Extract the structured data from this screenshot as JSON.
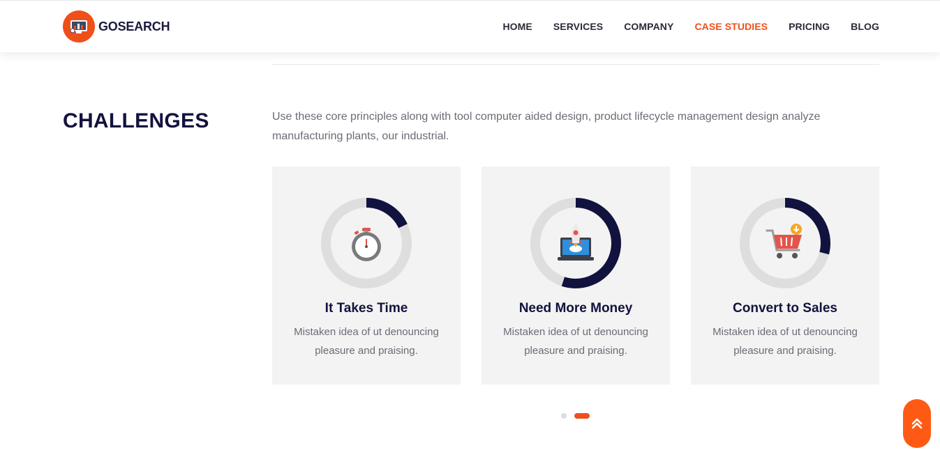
{
  "header": {
    "brand": "GOSEARCH",
    "nav": [
      {
        "label": "HOME"
      },
      {
        "label": "SERVICES"
      },
      {
        "label": "COMPANY"
      },
      {
        "label": "CASE STUDIES",
        "active": true
      },
      {
        "label": "PRICING"
      },
      {
        "label": "BLOG"
      }
    ]
  },
  "section": {
    "title": "CHALLENGES",
    "intro": "Use these core principles along with tool computer aided design, product lifecycle management design analyze manufacturing plants, our industrial."
  },
  "cards": [
    {
      "title": "It Takes Time",
      "text": "Mistaken idea of ut denouncing pleasure and praising.",
      "icon": "stopwatch-icon",
      "progress": 0.18
    },
    {
      "title": "Need More Money",
      "text": "Mistaken idea of ut denouncing pleasure and praising.",
      "icon": "rocket-laptop-icon",
      "progress": 0.55
    },
    {
      "title": "Convert to Sales",
      "text": "Mistaken idea of ut denouncing pleasure and praising.",
      "icon": "shopping-cart-icon",
      "progress": 0.29
    }
  ],
  "carousel": {
    "pages": 2,
    "active_page": 2
  },
  "colors": {
    "accent": "#ef4f1a",
    "navy": "#12123f",
    "card_bg": "#f3f3f3",
    "ring_track": "#dedede"
  }
}
